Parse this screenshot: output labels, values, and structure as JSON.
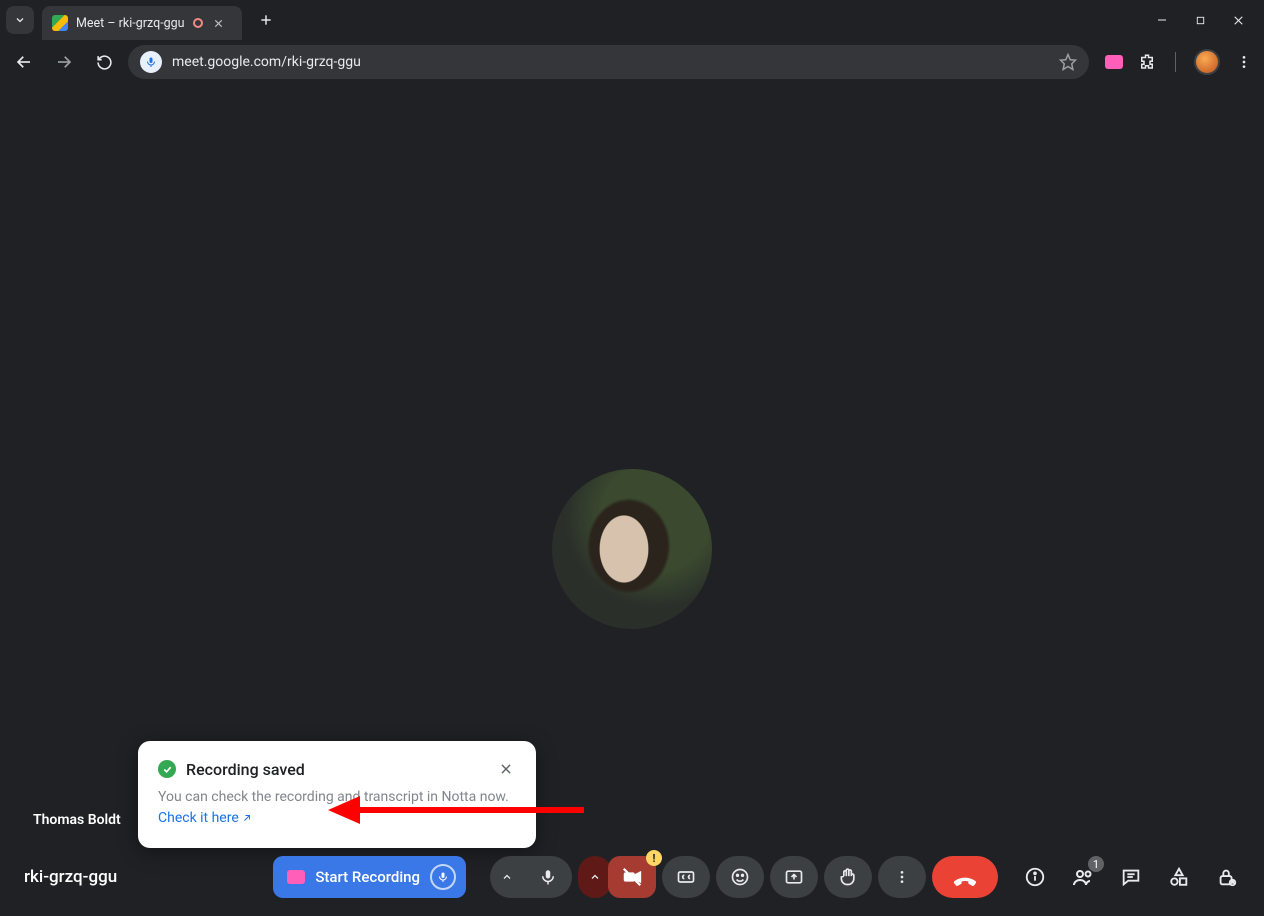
{
  "browser": {
    "tab_title": "Meet – rki-grzq-ggu",
    "url": "meet.google.com/rki-grzq-ggu"
  },
  "meet": {
    "participant_name": "Thomas Boldt",
    "meeting_code": "rki-grzq-ggu",
    "record_button_label": "Start Recording",
    "people_count": "1"
  },
  "toast": {
    "title": "Recording saved",
    "body_prefix": "You can check the recording and transcript in Notta now. ",
    "link_text": "Check it here"
  }
}
